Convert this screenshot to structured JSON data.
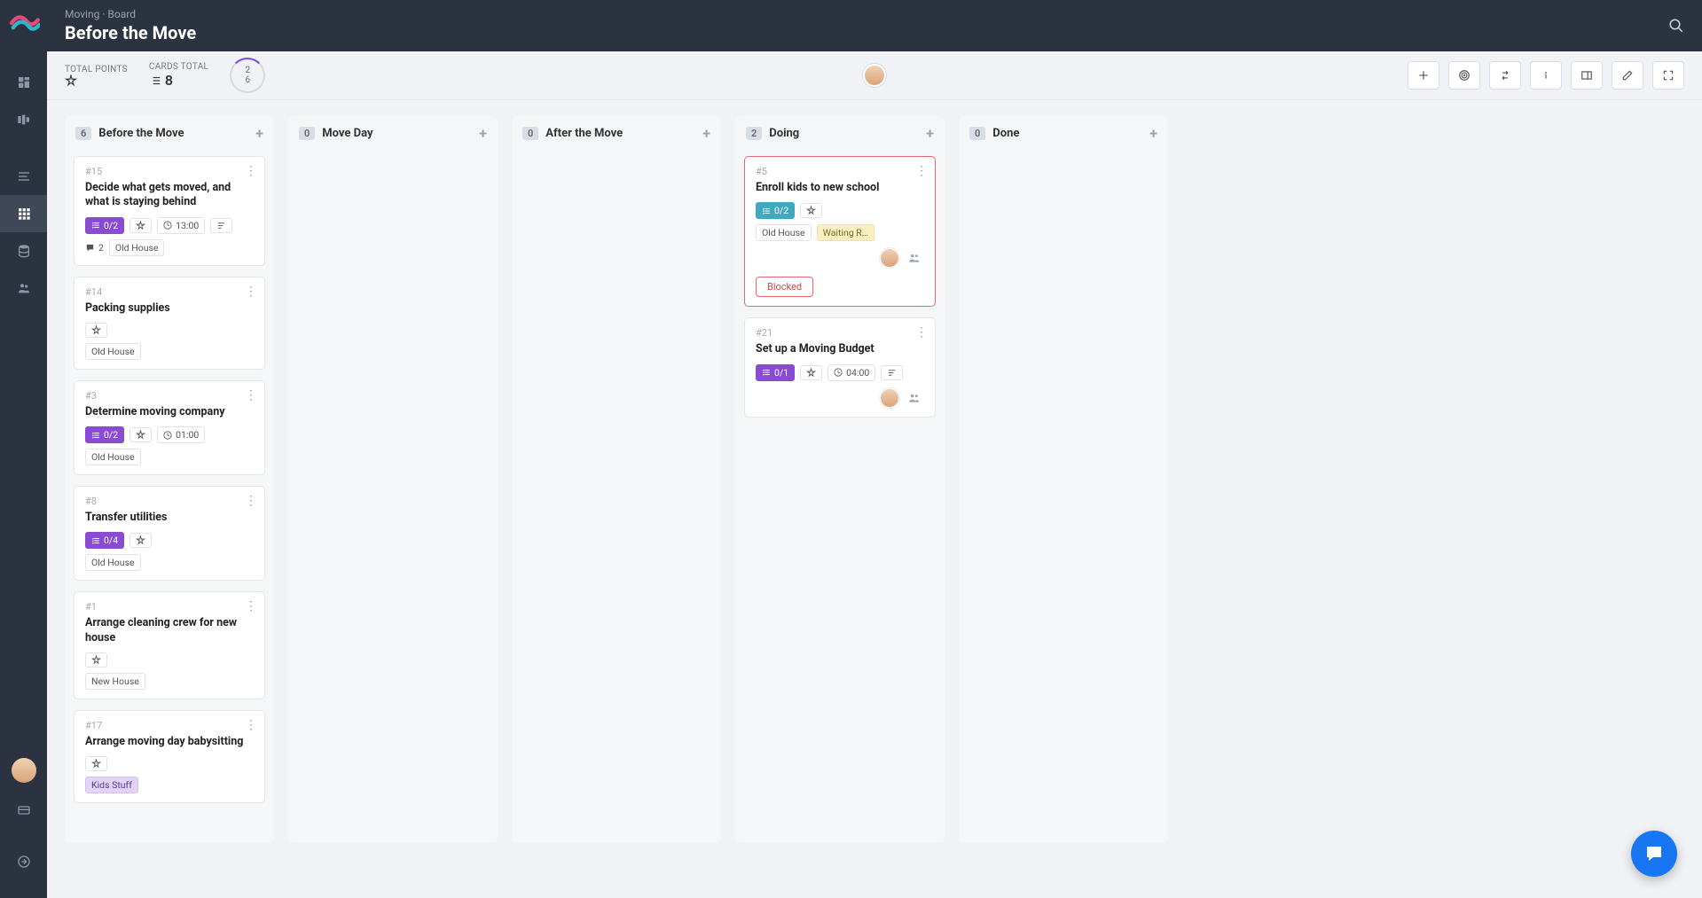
{
  "breadcrumb": "Moving · Board",
  "page_title": "Before the Move",
  "stats": {
    "total_points_label": "TOTAL POINTS",
    "cards_total_label": "CARDS TOTAL",
    "cards_total_value": "8",
    "ring_top": "2",
    "ring_bottom": "6"
  },
  "columns": [
    {
      "count": "6",
      "title": "Before the Move",
      "cards": [
        {
          "id": "#15",
          "title": "Decide what gets moved, and what is staying behind",
          "checklist": "0/2",
          "checklist_color": "purple",
          "points": true,
          "time": "13:00",
          "desc": true,
          "comments": "2",
          "tags": [
            {
              "text": "Old House",
              "style": "plain"
            }
          ]
        },
        {
          "id": "#14",
          "title": "Packing supplies",
          "points": true,
          "tags": [
            {
              "text": "Old House",
              "style": "plain"
            }
          ]
        },
        {
          "id": "#3",
          "title": "Determine moving company",
          "checklist": "0/2",
          "checklist_color": "purple",
          "points": true,
          "time": "01:00",
          "tags": [
            {
              "text": "Old House",
              "style": "plain"
            }
          ]
        },
        {
          "id": "#8",
          "title": "Transfer utilities",
          "checklist": "0/4",
          "checklist_color": "purple",
          "points": true,
          "tags": [
            {
              "text": "Old House",
              "style": "plain"
            }
          ]
        },
        {
          "id": "#1",
          "title": "Arrange cleaning crew for new house",
          "points": true,
          "tags": [
            {
              "text": "New House",
              "style": "plain"
            }
          ]
        },
        {
          "id": "#17",
          "title": "Arrange moving day babysitting",
          "points": true,
          "tags": [
            {
              "text": "Kids Stuff",
              "style": "purple"
            }
          ]
        }
      ]
    },
    {
      "count": "0",
      "title": "Move Day",
      "cards": []
    },
    {
      "count": "0",
      "title": "After the Move",
      "cards": []
    },
    {
      "count": "2",
      "title": "Doing",
      "cards": [
        {
          "id": "#5",
          "title": "Enroll kids to new school",
          "checklist": "0/2",
          "checklist_color": "teal",
          "points": true,
          "tags": [
            {
              "text": "Old House",
              "style": "plain"
            },
            {
              "text": "Waiting R…",
              "style": "yellow"
            }
          ],
          "blocked": true,
          "blocked_label": "Blocked",
          "assignee": true
        },
        {
          "id": "#21",
          "title": "Set up a Moving Budget",
          "checklist": "0/1",
          "checklist_color": "purple",
          "points": true,
          "time": "04:00",
          "desc": true,
          "assignee": true
        }
      ]
    },
    {
      "count": "0",
      "title": "Done",
      "cards": []
    }
  ]
}
